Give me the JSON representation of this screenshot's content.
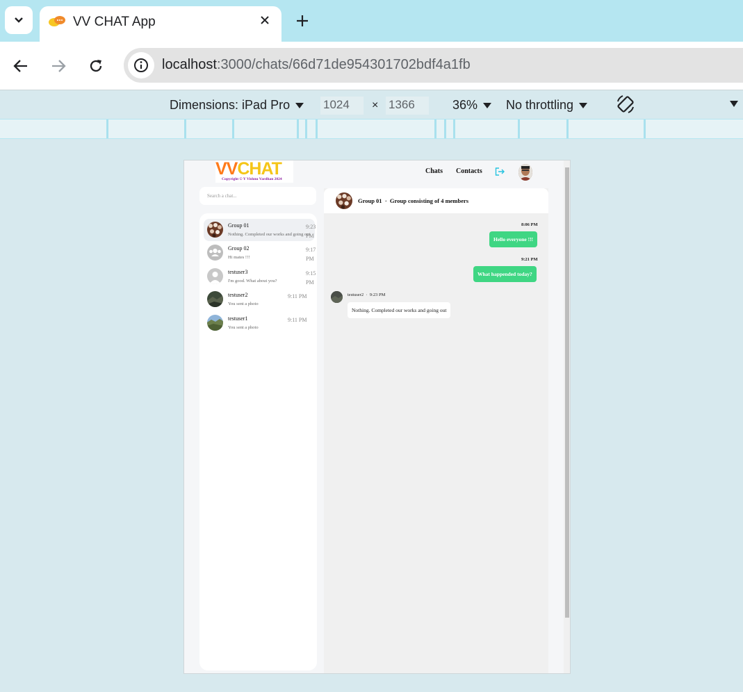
{
  "browser": {
    "tab_title": "VV CHAT App",
    "url_host": "localhost",
    "url_rest": ":3000/chats/66d71de954301702bdf4a1fb"
  },
  "devtools": {
    "dimensions_label": "Dimensions: iPad Pro",
    "width": "1024",
    "times": "×",
    "height": "1366",
    "zoom": "36%",
    "throttling": "No throttling"
  },
  "app": {
    "logo_vv": "VV",
    "logo_chat": "CHAT",
    "logo_copyright": "Copyright © Y Vishnu Vardhan 2024",
    "nav_chats": "Chats",
    "nav_contacts": "Contacts",
    "search_placeholder": "Search a chat...",
    "chats": [
      {
        "name": "Group 01",
        "preview": "Nothing. Completed our works and going out",
        "time_1": "9:23",
        "time_2": "PM",
        "avatar": "group-photo"
      },
      {
        "name": "Group 02",
        "preview": "Hi mates !!!",
        "time_1": "9:17",
        "time_2": "PM",
        "avatar": "group-default"
      },
      {
        "name": "testuser3",
        "preview": "I'm good. What about you?",
        "time_1": "9:15",
        "time_2": "PM",
        "avatar": "user-default"
      },
      {
        "name": "testuser2",
        "preview": "You sent a photo",
        "time_1": "9:11 PM",
        "time_2": "",
        "avatar": "landscape-dark"
      },
      {
        "name": "testuser1",
        "preview": "You sent a photo",
        "time_1": "9:11 PM",
        "time_2": "",
        "avatar": "landscape-green"
      }
    ],
    "conversation": {
      "title": "Group 01",
      "separator": "·",
      "subtitle": "Group consisting of 4 members",
      "messages": [
        {
          "direction": "out",
          "time": "8:06 PM",
          "text": "Hello everyone !!!"
        },
        {
          "direction": "out",
          "time": "9:21 PM",
          "text": "What happended today?"
        },
        {
          "direction": "in",
          "sender": "testuser2",
          "separator": "·",
          "time": "9:23 PM",
          "text": "Nothing. Completed our works and going out"
        }
      ]
    }
  },
  "colors": {
    "tabstrip": "#b5e6f1",
    "outgoing_bubble": "#3fd683",
    "logout_icon": "#27c3e0"
  }
}
